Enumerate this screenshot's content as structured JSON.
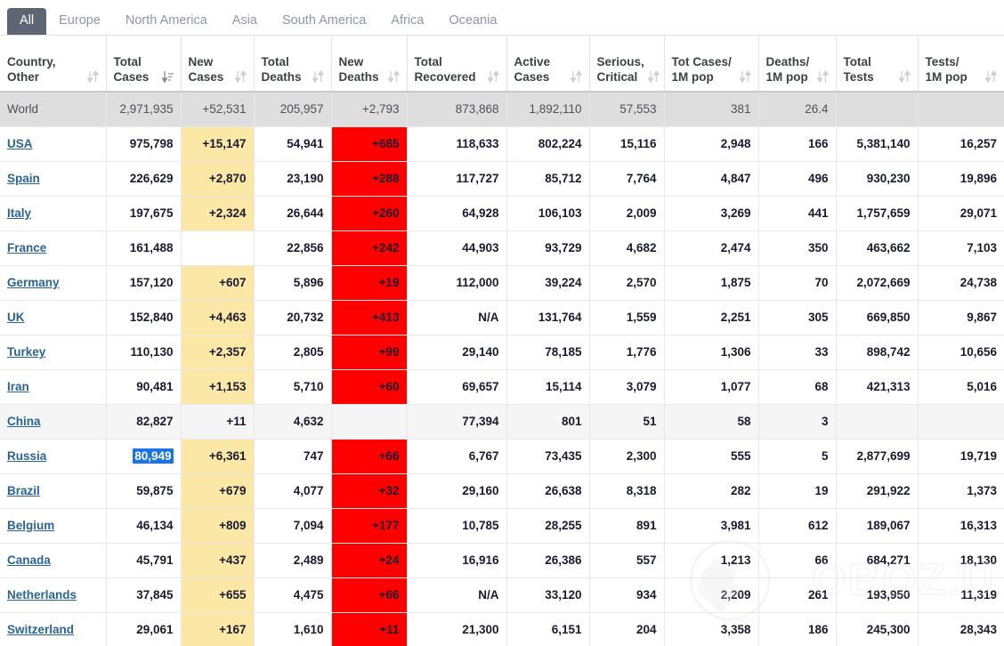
{
  "tabs": [
    {
      "label": "All",
      "active": true
    },
    {
      "label": "Europe",
      "active": false
    },
    {
      "label": "North America",
      "active": false
    },
    {
      "label": "Asia",
      "active": false
    },
    {
      "label": "South America",
      "active": false
    },
    {
      "label": "Africa",
      "active": false
    },
    {
      "label": "Oceania",
      "active": false
    }
  ],
  "watermark": {
    "text": "OBOZ.UA",
    "icon": "globe-icon"
  },
  "colors": {
    "accent_tab": "#5d6672",
    "link": "#2a6496",
    "new_cases_bg": "#fbe8a6",
    "new_deaths_bg": "#ff0000",
    "world_row_bg": "#dedede",
    "selection_bg": "#1a73e8"
  },
  "table": {
    "columns": [
      {
        "key": "country",
        "label": "Country,\nOther",
        "sorted": false
      },
      {
        "key": "total_cases",
        "label": "Total\nCases",
        "sorted": true
      },
      {
        "key": "new_cases",
        "label": "New\nCases",
        "sorted": false
      },
      {
        "key": "total_deaths",
        "label": "Total\nDeaths",
        "sorted": false
      },
      {
        "key": "new_deaths",
        "label": "New\nDeaths",
        "sorted": false
      },
      {
        "key": "total_recovered",
        "label": "Total\nRecovered",
        "sorted": false
      },
      {
        "key": "active_cases",
        "label": "Active\nCases",
        "sorted": false
      },
      {
        "key": "serious",
        "label": "Serious,\nCritical",
        "sorted": false
      },
      {
        "key": "cases_per_1m",
        "label": "Tot Cases/\n1M pop",
        "sorted": false
      },
      {
        "key": "deaths_per_1m",
        "label": "Deaths/\n1M pop",
        "sorted": false
      },
      {
        "key": "total_tests",
        "label": "Total\nTests",
        "sorted": false
      },
      {
        "key": "tests_per_1m",
        "label": "Tests/\n1M pop",
        "sorted": false
      }
    ],
    "rows": [
      {
        "country": "World",
        "is_world": true,
        "shaded": false,
        "link": false,
        "total_cases": "2,971,935",
        "new_cases": "+52,531",
        "total_deaths": "205,957",
        "new_deaths": "+2,793",
        "total_recovered": "873,868",
        "active_cases": "1,892,110",
        "serious": "57,553",
        "cases_per_1m": "381",
        "deaths_per_1m": "26.4",
        "total_tests": "",
        "tests_per_1m": ""
      },
      {
        "country": "USA",
        "is_world": false,
        "shaded": false,
        "link": true,
        "total_cases": "975,798",
        "new_cases": "+15,147",
        "total_deaths": "54,941",
        "new_deaths": "+685",
        "total_recovered": "118,633",
        "active_cases": "802,224",
        "serious": "15,116",
        "cases_per_1m": "2,948",
        "deaths_per_1m": "166",
        "total_tests": "5,381,140",
        "tests_per_1m": "16,257"
      },
      {
        "country": "Spain",
        "is_world": false,
        "shaded": false,
        "link": true,
        "total_cases": "226,629",
        "new_cases": "+2,870",
        "total_deaths": "23,190",
        "new_deaths": "+288",
        "total_recovered": "117,727",
        "active_cases": "85,712",
        "serious": "7,764",
        "cases_per_1m": "4,847",
        "deaths_per_1m": "496",
        "total_tests": "930,230",
        "tests_per_1m": "19,896"
      },
      {
        "country": "Italy",
        "is_world": false,
        "shaded": false,
        "link": true,
        "total_cases": "197,675",
        "new_cases": "+2,324",
        "total_deaths": "26,644",
        "new_deaths": "+260",
        "total_recovered": "64,928",
        "active_cases": "106,103",
        "serious": "2,009",
        "cases_per_1m": "3,269",
        "deaths_per_1m": "441",
        "total_tests": "1,757,659",
        "tests_per_1m": "29,071"
      },
      {
        "country": "France",
        "is_world": false,
        "shaded": false,
        "link": true,
        "total_cases": "161,488",
        "new_cases": "",
        "total_deaths": "22,856",
        "new_deaths": "+242",
        "total_recovered": "44,903",
        "active_cases": "93,729",
        "serious": "4,682",
        "cases_per_1m": "2,474",
        "deaths_per_1m": "350",
        "total_tests": "463,662",
        "tests_per_1m": "7,103"
      },
      {
        "country": "Germany",
        "is_world": false,
        "shaded": false,
        "link": true,
        "total_cases": "157,120",
        "new_cases": "+607",
        "total_deaths": "5,896",
        "new_deaths": "+19",
        "total_recovered": "112,000",
        "active_cases": "39,224",
        "serious": "2,570",
        "cases_per_1m": "1,875",
        "deaths_per_1m": "70",
        "total_tests": "2,072,669",
        "tests_per_1m": "24,738"
      },
      {
        "country": "UK",
        "is_world": false,
        "shaded": false,
        "link": true,
        "total_cases": "152,840",
        "new_cases": "+4,463",
        "total_deaths": "20,732",
        "new_deaths": "+413",
        "total_recovered": "N/A",
        "active_cases": "131,764",
        "serious": "1,559",
        "cases_per_1m": "2,251",
        "deaths_per_1m": "305",
        "total_tests": "669,850",
        "tests_per_1m": "9,867"
      },
      {
        "country": "Turkey",
        "is_world": false,
        "shaded": false,
        "link": true,
        "total_cases": "110,130",
        "new_cases": "+2,357",
        "total_deaths": "2,805",
        "new_deaths": "+99",
        "total_recovered": "29,140",
        "active_cases": "78,185",
        "serious": "1,776",
        "cases_per_1m": "1,306",
        "deaths_per_1m": "33",
        "total_tests": "898,742",
        "tests_per_1m": "10,656"
      },
      {
        "country": "Iran",
        "is_world": false,
        "shaded": false,
        "link": true,
        "total_cases": "90,481",
        "new_cases": "+1,153",
        "total_deaths": "5,710",
        "new_deaths": "+60",
        "total_recovered": "69,657",
        "active_cases": "15,114",
        "serious": "3,079",
        "cases_per_1m": "1,077",
        "deaths_per_1m": "68",
        "total_tests": "421,313",
        "tests_per_1m": "5,016"
      },
      {
        "country": "China",
        "is_world": false,
        "shaded": true,
        "link": true,
        "total_cases": "82,827",
        "new_cases": "+11",
        "total_deaths": "4,632",
        "new_deaths": "",
        "total_recovered": "77,394",
        "active_cases": "801",
        "serious": "51",
        "cases_per_1m": "58",
        "deaths_per_1m": "3",
        "total_tests": "",
        "tests_per_1m": ""
      },
      {
        "country": "Russia",
        "is_world": false,
        "shaded": false,
        "link": true,
        "total_cases": "80,949",
        "total_cases_selected": true,
        "new_cases": "+6,361",
        "total_deaths": "747",
        "new_deaths": "+66",
        "total_recovered": "6,767",
        "active_cases": "73,435",
        "serious": "2,300",
        "cases_per_1m": "555",
        "deaths_per_1m": "5",
        "total_tests": "2,877,699",
        "tests_per_1m": "19,719"
      },
      {
        "country": "Brazil",
        "is_world": false,
        "shaded": false,
        "link": true,
        "total_cases": "59,875",
        "new_cases": "+679",
        "total_deaths": "4,077",
        "new_deaths": "+32",
        "total_recovered": "29,160",
        "active_cases": "26,638",
        "serious": "8,318",
        "cases_per_1m": "282",
        "deaths_per_1m": "19",
        "total_tests": "291,922",
        "tests_per_1m": "1,373"
      },
      {
        "country": "Belgium",
        "is_world": false,
        "shaded": false,
        "link": true,
        "total_cases": "46,134",
        "new_cases": "+809",
        "total_deaths": "7,094",
        "new_deaths": "+177",
        "total_recovered": "10,785",
        "active_cases": "28,255",
        "serious": "891",
        "cases_per_1m": "3,981",
        "deaths_per_1m": "612",
        "total_tests": "189,067",
        "tests_per_1m": "16,313"
      },
      {
        "country": "Canada",
        "is_world": false,
        "shaded": false,
        "link": true,
        "total_cases": "45,791",
        "new_cases": "+437",
        "total_deaths": "2,489",
        "new_deaths": "+24",
        "total_recovered": "16,916",
        "active_cases": "26,386",
        "serious": "557",
        "cases_per_1m": "1,213",
        "deaths_per_1m": "66",
        "total_tests": "684,271",
        "tests_per_1m": "18,130"
      },
      {
        "country": "Netherlands",
        "is_world": false,
        "shaded": false,
        "link": true,
        "total_cases": "37,845",
        "new_cases": "+655",
        "total_deaths": "4,475",
        "new_deaths": "+66",
        "total_recovered": "N/A",
        "active_cases": "33,120",
        "serious": "934",
        "cases_per_1m": "2,209",
        "deaths_per_1m": "261",
        "total_tests": "193,950",
        "tests_per_1m": "11,319"
      },
      {
        "country": "Switzerland",
        "is_world": false,
        "shaded": false,
        "link": true,
        "total_cases": "29,061",
        "new_cases": "+167",
        "total_deaths": "1,610",
        "new_deaths": "+11",
        "total_recovered": "21,300",
        "active_cases": "6,151",
        "serious": "204",
        "cases_per_1m": "3,358",
        "deaths_per_1m": "186",
        "total_tests": "245,300",
        "tests_per_1m": "28,343"
      }
    ]
  }
}
